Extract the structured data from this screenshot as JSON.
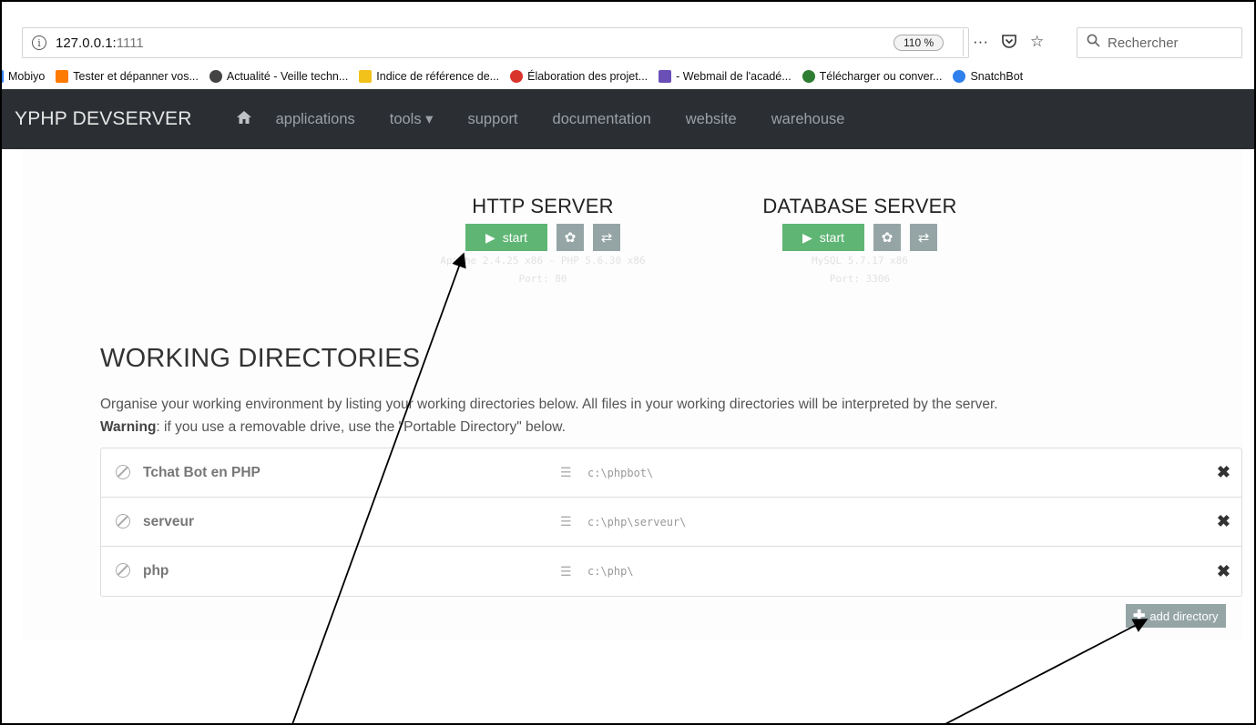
{
  "browser": {
    "url_host": "127.0.0.1:",
    "url_port": "1111",
    "zoom": "110 %",
    "search_placeholder": "Rechercher",
    "more_glyph": "···"
  },
  "bookmarks": [
    {
      "label": "Mobiyo",
      "color": "#ffffff"
    },
    {
      "label": "Tester et dépanner vos...",
      "color": "#ff7a00"
    },
    {
      "label": "Actualité - Veille techn...",
      "color": "#444444"
    },
    {
      "label": "Indice de référence de...",
      "color": "#f2c21b"
    },
    {
      "label": "Élaboration des projet...",
      "color": "#d9342b"
    },
    {
      "label": "- Webmail de l'acadé...",
      "color": "#6a4fb6"
    },
    {
      "label": "Télécharger ou conver...",
      "color": "#2e7d32"
    },
    {
      "label": "SnatchBot",
      "color": "#2f80ed"
    }
  ],
  "nav": {
    "brand": "YPHP DEVSERVER",
    "items": [
      "applications",
      "tools ▾",
      "support",
      "documentation",
      "website",
      "warehouse"
    ]
  },
  "servers": [
    {
      "title": "HTTP SERVER",
      "start_label": "start",
      "info1": "Apache 2.4.25 x86 - PHP 5.6.30 x86",
      "info2": "Port: 80"
    },
    {
      "title": "DATABASE SERVER",
      "start_label": "start",
      "info1": "MySQL 5.7.17 x86",
      "info2": "Port: 3306"
    }
  ],
  "working_dirs": {
    "title": "WORKING DIRECTORIES",
    "desc_line1": "Organise your working environment by listing your working directories below. All files in your working directories will be interpreted by the server.",
    "warning_label": "Warning",
    "desc_line2": ": if you use a removable drive, use the \"Portable Directory\" below.",
    "rows": [
      {
        "name": "Tchat Bot en PHP",
        "path": "c:\\phpbot\\"
      },
      {
        "name": "serveur",
        "path": "c:\\php\\serveur\\"
      },
      {
        "name": "php",
        "path": "c:\\php\\"
      }
    ],
    "add_label": "add directory"
  }
}
